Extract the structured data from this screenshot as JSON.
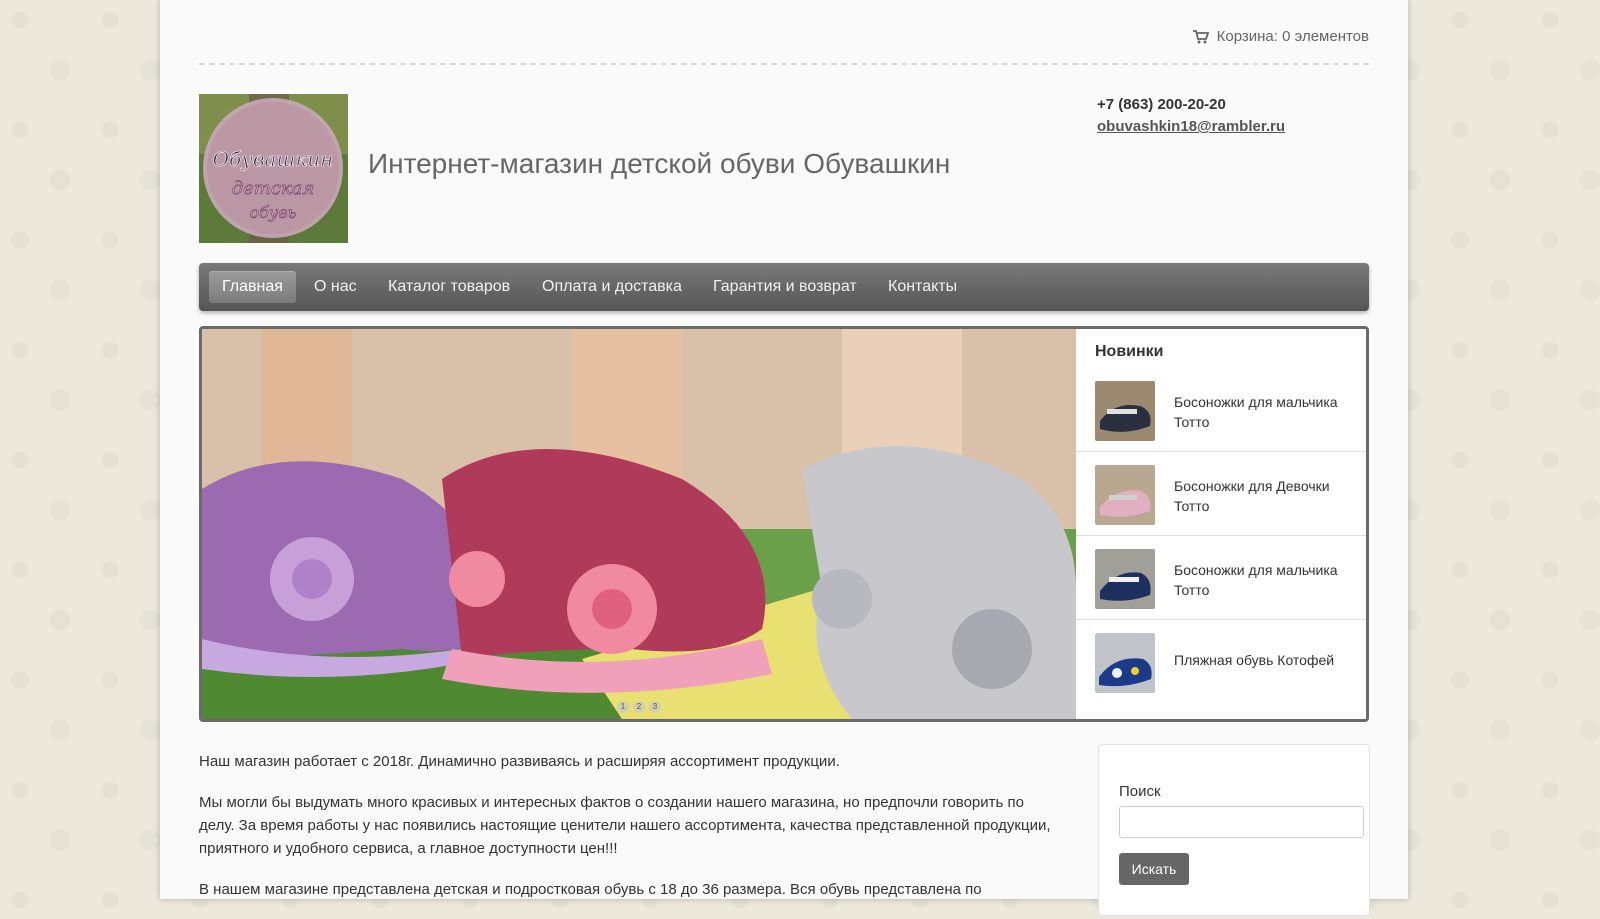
{
  "header": {
    "cart_label": "Корзина: 0 элементов",
    "site_title": "Интернет-магазин детской обуви Обувашкин",
    "phone": "+7 (863) 200-20-20",
    "email": "obuvashkin18@rambler.ru",
    "logo_text_line1": "Обувашкин",
    "logo_text_line2": "детская",
    "logo_text_line3": "обувь"
  },
  "nav": {
    "items": [
      {
        "label": "Главная",
        "active": true
      },
      {
        "label": "О нас"
      },
      {
        "label": "Каталог товаров"
      },
      {
        "label": "Оплата и доставка"
      },
      {
        "label": "Гарантия и возврат"
      },
      {
        "label": "Контакты"
      }
    ]
  },
  "slider": {
    "dots": [
      "1",
      "2",
      "3"
    ]
  },
  "news": {
    "title": "Новинки",
    "items": [
      {
        "label": "Босоножки для мальчика Тотто"
      },
      {
        "label": "Босоножки для Девочки Тотто"
      },
      {
        "label": "Босоножки для мальчика Тотто"
      },
      {
        "label": "Пляжная обувь Котофей"
      }
    ]
  },
  "content": {
    "p1": "Наш магазин работает с 2018г. Динамично развиваясь и расширяя ассортимент продукции.",
    "p2": "Мы могли бы выдумать много красивых и интересных фактов о создании нашего магазина, но предпочли говорить по делу. За время работы у нас появились настоящие ценители нашего ассортимента, качества представленной продукции, приятного и удобного сервиса, а главное доступности цен!!!",
    "p3": "В нашем магазине представлена детская и подростковая обувь с 18 до 36 размера. Вся обувь представлена по"
  },
  "search": {
    "label": "Поиск",
    "button": "Искать",
    "value": ""
  },
  "colors": {
    "nav_bg": "#666666",
    "page_bg": "#fafafa",
    "body_bg": "#ece9dc"
  }
}
